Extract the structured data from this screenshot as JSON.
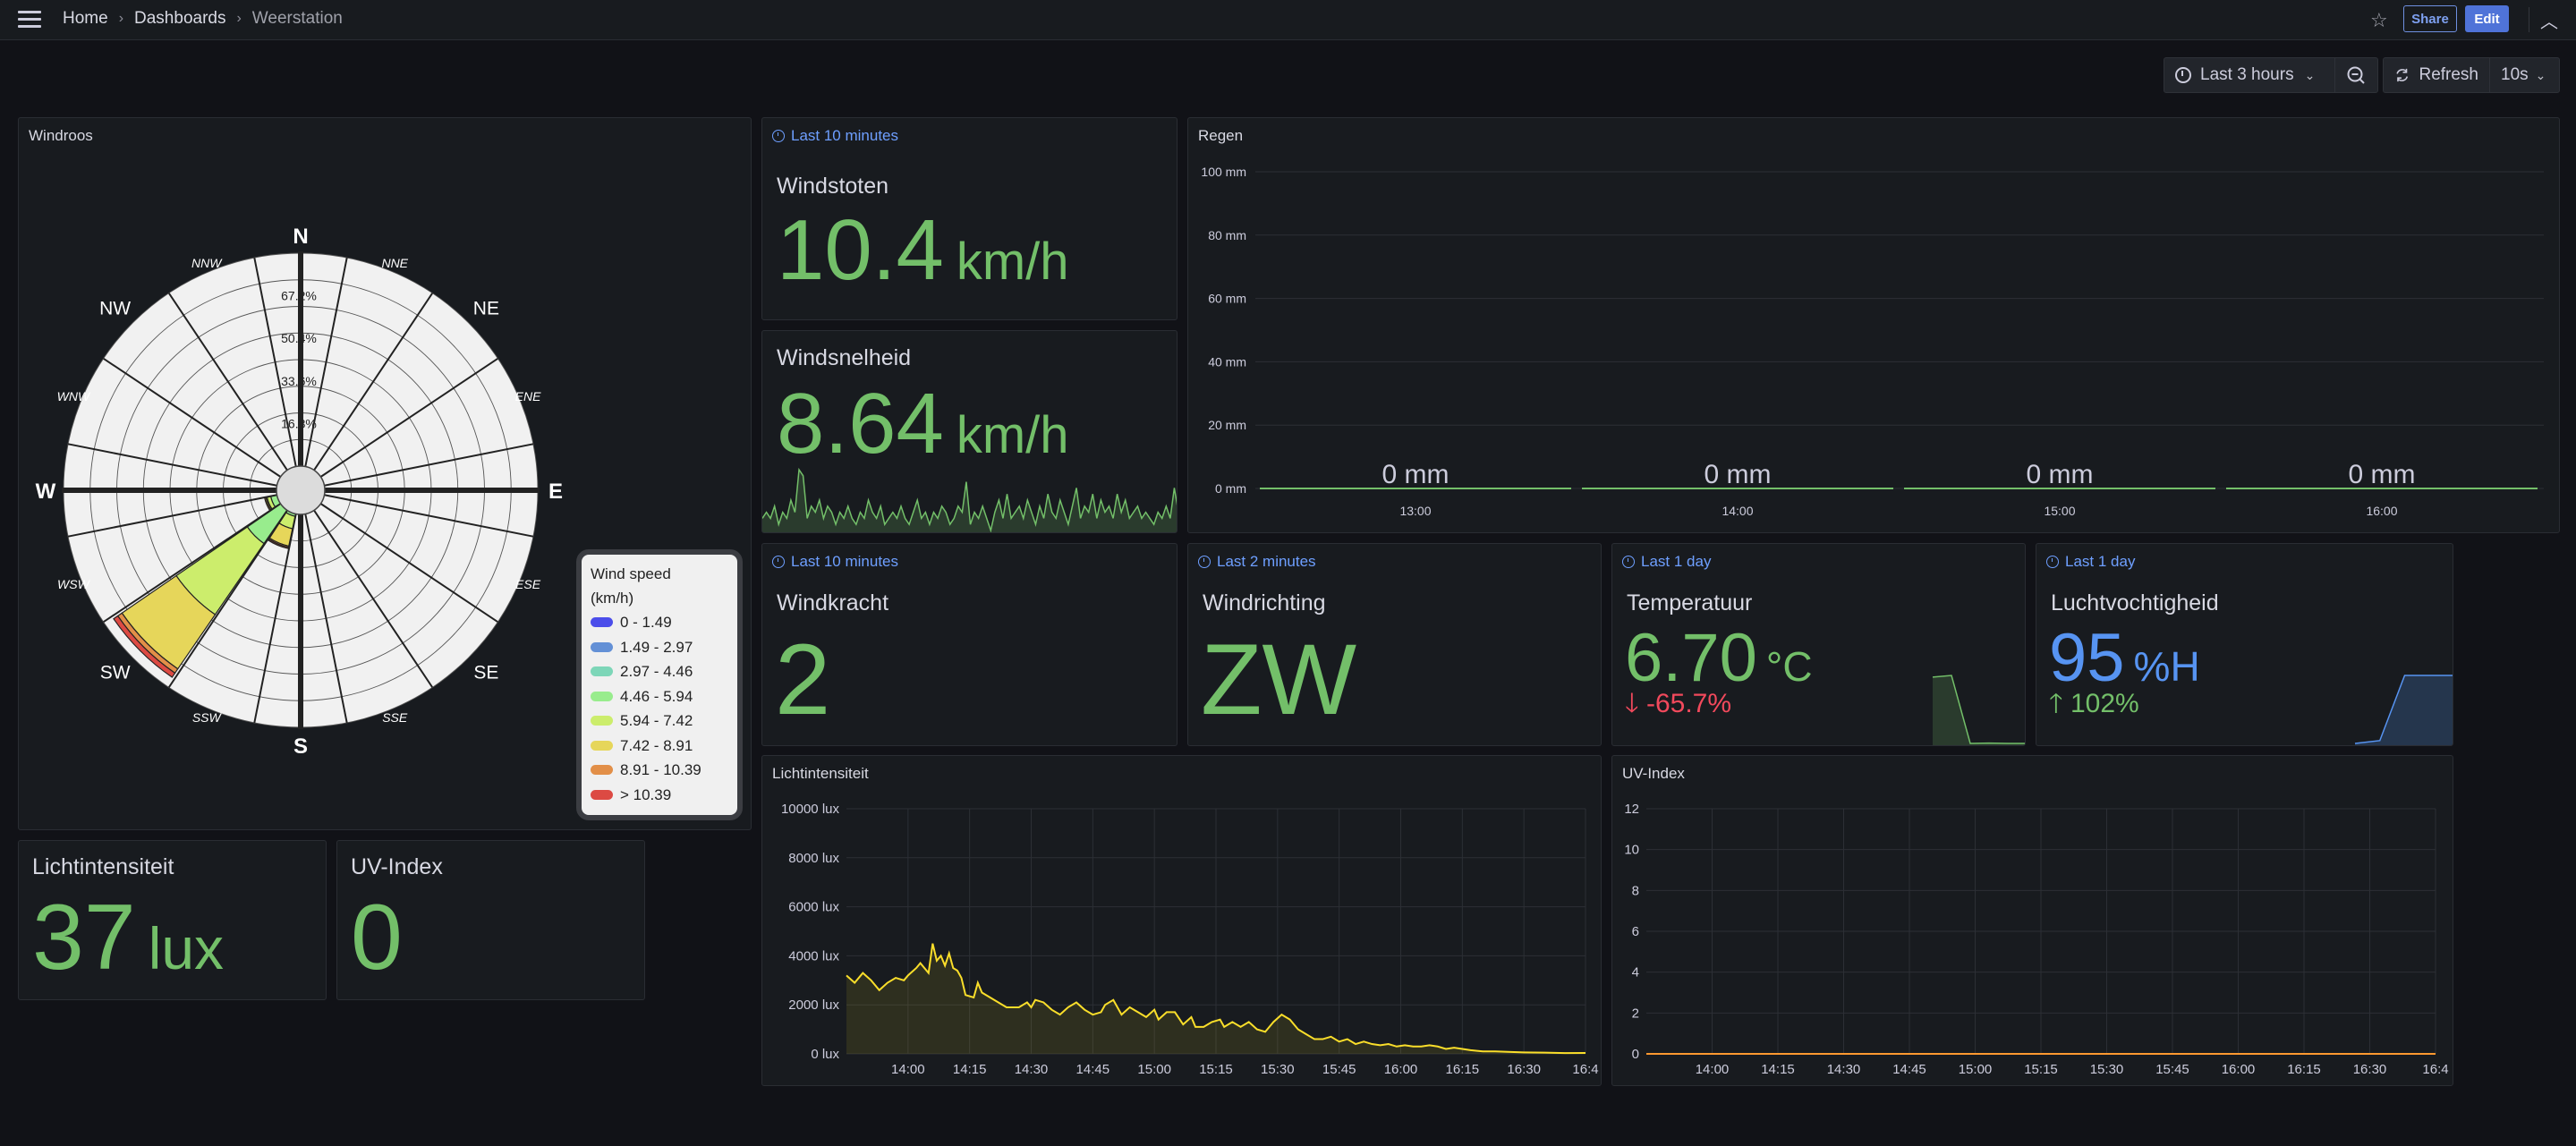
{
  "topbar": {
    "breadcrumb": [
      "Home",
      "Dashboards",
      "Weerstation"
    ],
    "share_label": "Share",
    "edit_label": "Edit"
  },
  "toolbar": {
    "time_range": "Last 3 hours",
    "refresh_label": "Refresh",
    "refresh_interval": "10s"
  },
  "panels": {
    "windroos": {
      "title": "Windroos",
      "legend_title": "Wind speed",
      "legend_unit": "(km/h)"
    },
    "windstoten": {
      "time_override": "Last 10 minutes",
      "title": "Windstoten",
      "value": "10.4",
      "unit": "km/h"
    },
    "windsnelheid": {
      "title": "Windsnelheid",
      "value": "8.64",
      "unit": "km/h"
    },
    "regen": {
      "title": "Regen"
    },
    "windkracht": {
      "time_override": "Last 10 minutes",
      "title": "Windkracht",
      "value": "2"
    },
    "windrichting": {
      "time_override": "Last 2 minutes",
      "title": "Windrichting",
      "value": "ZW"
    },
    "temperatuur": {
      "time_override": "Last 1 day",
      "title": "Temperatuur",
      "value": "6.70",
      "unit": "°C",
      "change": "-65.7%",
      "change_dir": "down"
    },
    "luchtvochtigheid": {
      "time_override": "Last 1 day",
      "title": "Luchtvochtigheid",
      "value": "95",
      "unit": "%H",
      "change": "102%",
      "change_dir": "up"
    },
    "lichtintensiteit_chart": {
      "title": "Lichtintensiteit"
    },
    "uv_chart": {
      "title": "UV-Index"
    },
    "lichtintensiteit_stat": {
      "title": "Lichtintensiteit",
      "value": "37",
      "unit": "lux"
    },
    "uv_stat": {
      "title": "UV-Index",
      "value": "0"
    }
  },
  "colors": {
    "stat_green": "#73bf69",
    "stat_blue": "#5794f2",
    "stat_red": "#f2495c",
    "light_line": "#fade2a",
    "uv_line": "#ff9830",
    "accent": "#6e9fff"
  },
  "chart_data": [
    {
      "name": "windroos",
      "type": "polar-bar",
      "title": "Windroos",
      "directions": [
        "N",
        "NNE",
        "NE",
        "ENE",
        "E",
        "ESE",
        "SE",
        "SSE",
        "S",
        "SSW",
        "SW",
        "WSW",
        "W",
        "WNW",
        "NW",
        "NNW"
      ],
      "cardinal": [
        "N",
        "E",
        "S",
        "W"
      ],
      "radial_ticks": [
        "16.8%",
        "33.6%",
        "50.4%",
        "67.2%"
      ],
      "radial_max": 84.0,
      "legend_title": "Wind speed (km/h)",
      "legend": [
        {
          "label": "0 - 1.49",
          "color": "#4b4dea"
        },
        {
          "label": "1.49 - 2.97",
          "color": "#6390d6"
        },
        {
          "label": "2.97 - 4.46",
          "color": "#7dd6b8"
        },
        {
          "label": "4.46 - 5.94",
          "color": "#98ec8d"
        },
        {
          "label": "5.94 - 7.42",
          "color": "#cced6c"
        },
        {
          "label": "7.42 - 8.91",
          "color": "#e6d65a"
        },
        {
          "label": "8.91 - 10.39",
          "color": "#e28f48"
        },
        {
          "label": "> 10.39",
          "color": "#dc4a43"
        }
      ],
      "series_cumulative_pct": {
        "SW": [
          0,
          0,
          0,
          16,
          50,
          76,
          78,
          80
        ],
        "SSW": [
          0,
          0,
          0,
          1,
          6,
          13,
          13.5,
          14
        ],
        "WSW": [
          0,
          0,
          0,
          2.5,
          4,
          4.5,
          5,
          5
        ]
      }
    },
    {
      "name": "regen",
      "type": "bar",
      "title": "Regen",
      "categories": [
        "13:00",
        "14:00",
        "15:00",
        "16:00"
      ],
      "values": [
        0,
        0,
        0,
        0
      ],
      "value_labels": [
        "0 mm",
        "0 mm",
        "0 mm",
        "0 mm"
      ],
      "yticks": [
        "0 mm",
        "20 mm",
        "40 mm",
        "60 mm",
        "80 mm",
        "100 mm"
      ],
      "ylim": [
        0,
        100
      ]
    },
    {
      "name": "lichtintensiteit",
      "type": "area",
      "title": "Lichtintensiteit",
      "x_ticks": [
        "14:00",
        "14:15",
        "14:30",
        "14:45",
        "15:00",
        "15:15",
        "15:30",
        "15:45",
        "16:00",
        "16:15",
        "16:30",
        "16:4"
      ],
      "yticks": [
        "0 lux",
        "2000 lux",
        "4000 lux",
        "6000 lux",
        "8000 lux",
        "10000 lux"
      ],
      "ylim": [
        0,
        10000
      ],
      "x_range_minutes": [
        -15,
        165
      ],
      "points": [
        [
          -15,
          3200
        ],
        [
          -13,
          2900
        ],
        [
          -11,
          3300
        ],
        [
          -9,
          3000
        ],
        [
          -7,
          2600
        ],
        [
          -5,
          2900
        ],
        [
          -3,
          3100
        ],
        [
          -1,
          3000
        ],
        [
          0,
          3200
        ],
        [
          2,
          3500
        ],
        [
          3,
          3700
        ],
        [
          5,
          3300
        ],
        [
          6,
          4500
        ],
        [
          7,
          3800
        ],
        [
          8,
          4000
        ],
        [
          9,
          3600
        ],
        [
          10,
          4100
        ],
        [
          11,
          3500
        ],
        [
          12,
          3400
        ],
        [
          13,
          3100
        ],
        [
          14,
          2400
        ],
        [
          16,
          2300
        ],
        [
          17,
          2900
        ],
        [
          18,
          2500
        ],
        [
          20,
          2300
        ],
        [
          22,
          2100
        ],
        [
          24,
          1900
        ],
        [
          27,
          1900
        ],
        [
          29,
          2100
        ],
        [
          30,
          1900
        ],
        [
          31,
          2200
        ],
        [
          33,
          2100
        ],
        [
          35,
          1800
        ],
        [
          37,
          1600
        ],
        [
          39,
          1900
        ],
        [
          41,
          2100
        ],
        [
          43,
          1800
        ],
        [
          45,
          1600
        ],
        [
          47,
          1700
        ],
        [
          48,
          2000
        ],
        [
          50,
          2200
        ],
        [
          52,
          1600
        ],
        [
          54,
          1900
        ],
        [
          56,
          1700
        ],
        [
          58,
          1500
        ],
        [
          60,
          1800
        ],
        [
          61,
          1400
        ],
        [
          63,
          1700
        ],
        [
          65,
          1700
        ],
        [
          67,
          1200
        ],
        [
          69,
          1500
        ],
        [
          70,
          1100
        ],
        [
          72,
          1100
        ],
        [
          74,
          1300
        ],
        [
          76,
          1400
        ],
        [
          77,
          1100
        ],
        [
          79,
          1300
        ],
        [
          81,
          1100
        ],
        [
          83,
          1300
        ],
        [
          85,
          1000
        ],
        [
          87,
          900
        ],
        [
          89,
          1300
        ],
        [
          91,
          1600
        ],
        [
          93,
          1400
        ],
        [
          95,
          1000
        ],
        [
          97,
          800
        ],
        [
          99,
          600
        ],
        [
          101,
          600
        ],
        [
          103,
          700
        ],
        [
          105,
          500
        ],
        [
          107,
          600
        ],
        [
          109,
          400
        ],
        [
          111,
          500
        ],
        [
          113,
          400
        ],
        [
          115,
          350
        ],
        [
          117,
          400
        ],
        [
          119,
          300
        ],
        [
          121,
          350
        ],
        [
          123,
          300
        ],
        [
          125,
          300
        ],
        [
          127,
          350
        ],
        [
          129,
          300
        ],
        [
          131,
          200
        ],
        [
          133,
          250
        ],
        [
          135,
          200
        ],
        [
          137,
          150
        ],
        [
          140,
          100
        ],
        [
          143,
          100
        ],
        [
          146,
          80
        ],
        [
          150,
          60
        ],
        [
          155,
          50
        ],
        [
          160,
          30
        ],
        [
          165,
          37
        ]
      ]
    },
    {
      "name": "uv_index",
      "type": "line",
      "title": "UV-Index",
      "x_ticks": [
        "14:00",
        "14:15",
        "14:30",
        "14:45",
        "15:00",
        "15:15",
        "15:30",
        "15:45",
        "16:00",
        "16:15",
        "16:30",
        "16:4"
      ],
      "yticks": [
        "0",
        "2",
        "4",
        "6",
        "8",
        "10",
        "12"
      ],
      "ylim": [
        0,
        12
      ],
      "x_range_minutes": [
        -15,
        165
      ],
      "points": [
        [
          -15,
          0
        ],
        [
          165,
          0
        ]
      ]
    },
    {
      "name": "windsnelheid_sparkline",
      "type": "area",
      "values": [
        6,
        7,
        6,
        8,
        5,
        7,
        6,
        9,
        7,
        14,
        13,
        6,
        8,
        7,
        9,
        6,
        8,
        7,
        5,
        7,
        6,
        8,
        6,
        5,
        7,
        6,
        9,
        7,
        6,
        8,
        5,
        6,
        7,
        6,
        8,
        6,
        5,
        7,
        9,
        6,
        7,
        5,
        7,
        6,
        8,
        7,
        5,
        6,
        8,
        7,
        12,
        5,
        7,
        6,
        8,
        6,
        4,
        7,
        9,
        6,
        10,
        6,
        7,
        8,
        6,
        9,
        7,
        5,
        8,
        6,
        10,
        7,
        6,
        9,
        7,
        5,
        8,
        11,
        6,
        8,
        7,
        10,
        6,
        9,
        7,
        8,
        6,
        10,
        7,
        9,
        6,
        7,
        8,
        6,
        7,
        6,
        5,
        7,
        6,
        8,
        6,
        11,
        7
      ]
    },
    {
      "name": "temperatuur_sparkline",
      "type": "area",
      "values": [
        19.5,
        20,
        0.2,
        0.3,
        0.2,
        0.2
      ]
    },
    {
      "name": "luchtvochtigheid_sparkline",
      "type": "area",
      "values": [
        47,
        49,
        95,
        95,
        95
      ]
    }
  ]
}
